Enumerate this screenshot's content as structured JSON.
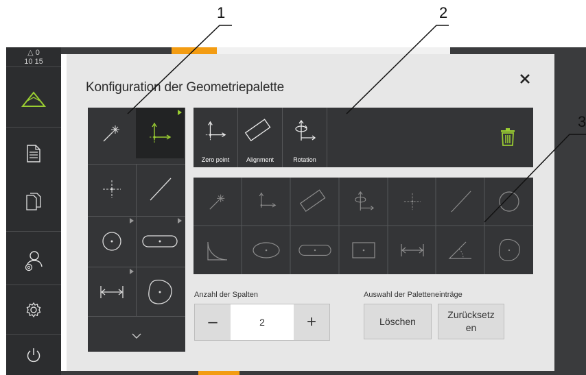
{
  "status": {
    "delta": "△ 0",
    "time": "10 15"
  },
  "sidebar": {
    "items": [
      {
        "icon": "measure-triangle-icon"
      },
      {
        "icon": "report-icon"
      },
      {
        "icon": "files-icon"
      },
      {
        "icon": "user-settings-icon"
      },
      {
        "icon": "settings-icon"
      },
      {
        "icon": "power-icon"
      }
    ]
  },
  "dialog": {
    "title": "Konfiguration der Geometriepalette",
    "close_icon": "close-icon"
  },
  "palette": {
    "items": [
      {
        "icon": "magic-wand-icon"
      },
      {
        "icon": "zero-point-icon",
        "active": true,
        "has_submenu": true
      },
      {
        "icon": "point-icon"
      },
      {
        "icon": "line-icon"
      },
      {
        "icon": "circle-icon",
        "has_submenu": true
      },
      {
        "icon": "slot-icon",
        "has_submenu": true
      },
      {
        "icon": "distance-icon",
        "has_submenu": true
      },
      {
        "icon": "freeform-icon"
      }
    ],
    "more_icon": "chevron-down-icon"
  },
  "group": {
    "items": [
      {
        "label": "Zero point",
        "icon": "zero-point-icon"
      },
      {
        "label": "Alignment",
        "icon": "alignment-icon"
      },
      {
        "label": "Rotation",
        "icon": "rotation-icon"
      }
    ],
    "delete_icon": "trash-icon",
    "accent": "#9acd32"
  },
  "all_entries": {
    "items": [
      "magic-wand-icon",
      "zero-point-icon",
      "alignment-icon",
      "rotation-icon",
      "point-icon",
      "line-icon",
      "circle-icon",
      "arc-icon",
      "ellipse-icon",
      "slot-icon",
      "rectangle-icon",
      "distance-icon",
      "angle-icon",
      "freeform-icon"
    ]
  },
  "columns": {
    "label": "Anzahl der Spalten",
    "value": "2",
    "minus": "–",
    "plus": "+"
  },
  "selection": {
    "label": "Auswahl der Paletteneinträge",
    "delete_label": "Löschen",
    "reset_label": "Zurücksetz en"
  },
  "callouts": [
    "1",
    "2",
    "3"
  ]
}
